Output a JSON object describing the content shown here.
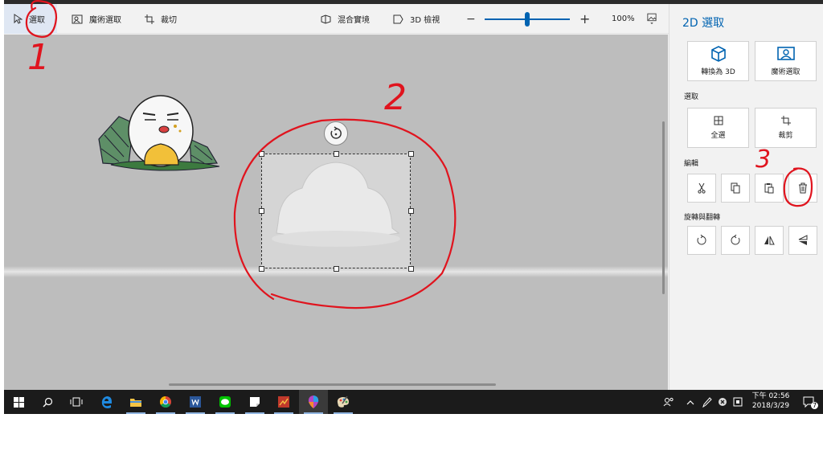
{
  "toolbar": {
    "select_label": "選取",
    "magic_select_label": "魔術選取",
    "crop_label": "裁切",
    "mixed_reality_label": "混合實境",
    "view3d_label": "3D 檢視",
    "zoom_minus": "−",
    "zoom_plus": "+",
    "zoom_value": "100%"
  },
  "panel": {
    "title": "2D 選取",
    "convert3d_label": "轉換為 3D",
    "magic_select_label": "魔術選取",
    "select_section": "選取",
    "select_all_label": "全選",
    "crop_label": "裁剪",
    "edit_section": "編輯",
    "rotate_section": "旋轉與翻轉"
  },
  "taskbar": {
    "clock_time": "下午 02:56",
    "clock_date": "2018/3/29",
    "notification_count": "7"
  },
  "annotations": {
    "one": "1",
    "two": "2",
    "three": "3",
    "color": "#e0141e"
  },
  "colors": {
    "accent": "#0063b1",
    "canvas": "#bdbdbd",
    "taskbar": "#1b1b1b"
  }
}
